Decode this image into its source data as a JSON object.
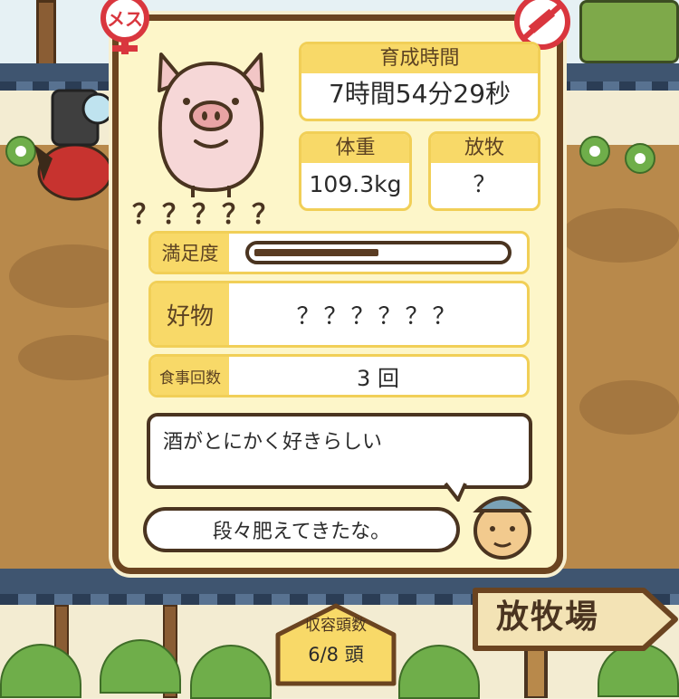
{
  "pig": {
    "gender": "メス",
    "name": "？？？？？"
  },
  "stats": {
    "rearing_time_label": "育成時間",
    "rearing_time_value": "7時間54分29秒",
    "weight_label": "体重",
    "weight_value": "109.3kg",
    "grazing_label": "放牧",
    "grazing_value": "？"
  },
  "satisfaction": {
    "label": "満足度",
    "level": 0.5
  },
  "favorite": {
    "label": "好物",
    "value": "？？？？？？"
  },
  "meals": {
    "label": "食事回数",
    "value": "3 回"
  },
  "trait_text": "酒がとにかく好きらしい",
  "farmer_comment": "段々肥えてきたな。",
  "capacity": {
    "label": "収容頭数",
    "value": "6/8 頭"
  },
  "location_sign": "放牧場",
  "icons": {
    "gender": "female-symbol-icon",
    "syringe": "no-syringe-icon"
  },
  "colors": {
    "panel_bg": "#fdf6c9",
    "panel_border": "#6b4420",
    "label_yellow": "#f8d968",
    "gender_red": "#d9363e"
  }
}
